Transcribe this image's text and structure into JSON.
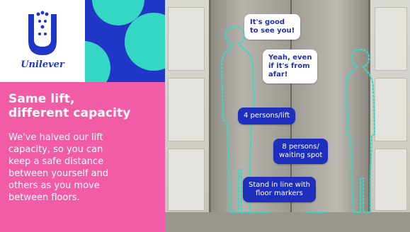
{
  "brand": {
    "name": "Unilever"
  },
  "panel": {
    "headline": "Same lift,\ndifferent capacity",
    "body": "We've halved our lift\ncapacity, so you can\nkeep a safe distance\nbetween yourself and\nothers as you move\nbetween floors."
  },
  "bubbles": {
    "greeting": "It's good\nto see you!",
    "reply": "Yeah, even\nif it's from\nafar!",
    "capacity": "4 persons/lift",
    "waiting": "8 persons/\nwaiting spot",
    "queue": "Stand in line with\nfloor markers"
  },
  "colors": {
    "pink": "#f25ca6",
    "blue": "#1f36c7",
    "teal": "#34d6c4",
    "logo_blue": "#1f36c7"
  }
}
